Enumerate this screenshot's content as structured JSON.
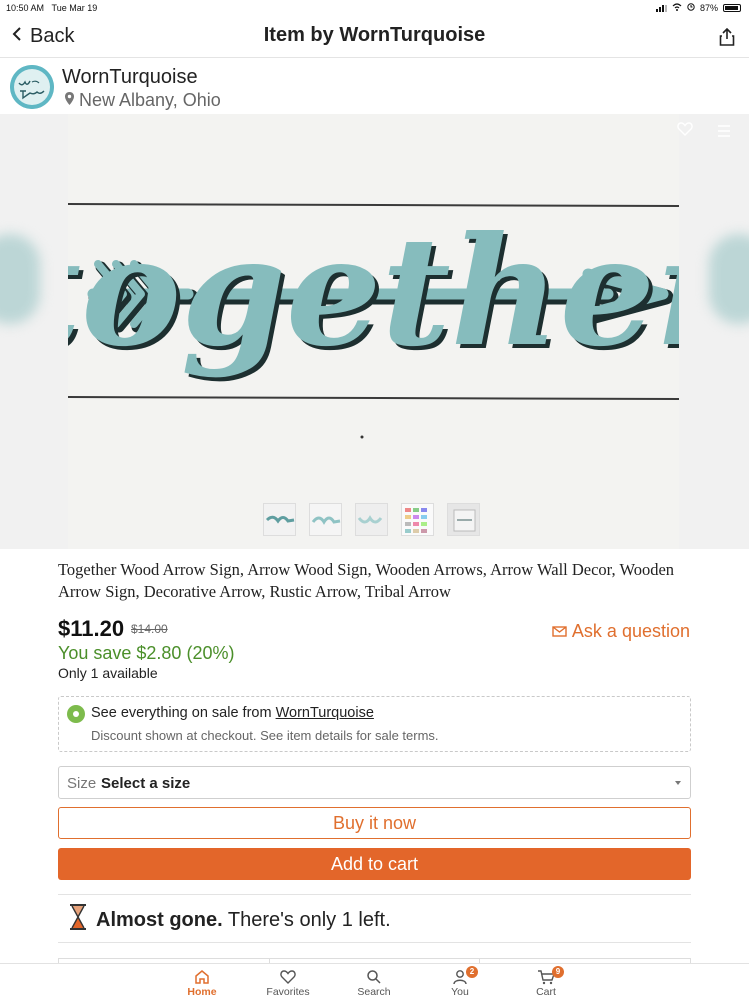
{
  "status_bar": {
    "time": "10:50 AM",
    "date": "Tue Mar 19",
    "battery": "87%"
  },
  "nav": {
    "back_label": "Back",
    "title": "Item by WornTurquoise"
  },
  "shop": {
    "name": "WornTurquoise",
    "location": "New Albany, Ohio",
    "logo_text": "Worn Turquoise"
  },
  "hero": {
    "sign_text": "together"
  },
  "listing": {
    "title": "Together Wood Arrow Sign, Arrow Wood Sign, Wooden Arrows, Arrow Wall Decor, Wooden Arrow Sign, Decorative Arrow, Rustic Arrow, Tribal Arrow",
    "price": "$11.20",
    "original_price": "$14.00",
    "savings": "You save $2.80 (20%)",
    "availability": "Only 1 available",
    "ask_label": "Ask a question"
  },
  "sale": {
    "line1_prefix": "See everything on sale from ",
    "line1_link": "WornTurquoise",
    "line2": "Discount shown at checkout. See item details for sale terms."
  },
  "size_select": {
    "label": "Size",
    "value": "Select a size"
  },
  "buttons": {
    "buy_now": "Buy it now",
    "add_to_cart": "Add to cart"
  },
  "scarcity": {
    "bold": "Almost gone.",
    "rest": " There's only 1 left."
  },
  "tabbar": {
    "items": [
      {
        "label": "Home",
        "icon": "home-icon",
        "active": true
      },
      {
        "label": "Favorites",
        "icon": "heart-icon"
      },
      {
        "label": "Search",
        "icon": "search-icon"
      },
      {
        "label": "You",
        "icon": "user-icon",
        "badge": "2"
      },
      {
        "label": "Cart",
        "icon": "cart-icon",
        "badge": "9"
      }
    ]
  },
  "colors": {
    "accent": "#e06f2e",
    "savings": "#4b8f2a",
    "sign": "#7fb6b8"
  }
}
